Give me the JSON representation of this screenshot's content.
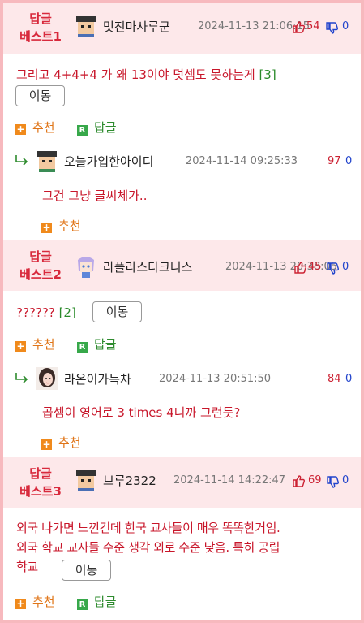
{
  "colors": {
    "border": "#f7b9be",
    "header_bg": "#fde8ea",
    "best_label": "#d8293c",
    "body_text": "#c8162a",
    "upvote": "#cc2233",
    "downvote": "#2244cc",
    "recommend": "#e0761a",
    "reply": "#2e8b2e"
  },
  "comments": [
    {
      "best_line1": "답글",
      "best_line2": "베스트1",
      "nickname": "멋진마사루군",
      "date": "2024-11-13 21:06:15",
      "upvotes": "54",
      "downvotes": "0",
      "text": "그리고 4+4+4 가 왜 13이야 덧셈도 못하는게",
      "reply_count": "[3]",
      "move_label": "이동",
      "recommend_label": "추천",
      "reply_label": "답글",
      "reply": {
        "nickname": "오늘가입한아이디",
        "date": "2024-11-14 09:25:33",
        "upvotes": "97",
        "downvotes": "0",
        "text": "그건 그냥 글씨체가..",
        "recommend_label": "추천"
      }
    },
    {
      "best_line1": "답글",
      "best_line2": "베스트2",
      "nickname": "라플라스다크니스",
      "date": "2024-11-13 20:38:05",
      "upvotes": "45",
      "downvotes": "0",
      "text": "??????",
      "reply_count": "[2]",
      "move_label": "이동",
      "recommend_label": "추천",
      "reply_label": "답글",
      "reply": {
        "nickname": "라온이가득차",
        "date": "2024-11-13 20:51:50",
        "upvotes": "84",
        "downvotes": "0",
        "text": "곱셈이 영어로 3 times 4니까 그런듯?",
        "recommend_label": "추천"
      }
    },
    {
      "best_line1": "답글",
      "best_line2": "베스트3",
      "nickname": "브루2322",
      "date": "2024-11-14 14:22:47",
      "upvotes": "69",
      "downvotes": "0",
      "text_line1": "외국 나가면 느낀건데 한국 교사들이 매우 똑똑한거임.",
      "text_line2": "외국 학교 교사들 수준 생각 외로 수준 낮음. 특히 공립",
      "text_line3": "학교",
      "move_label": "이동",
      "recommend_label": "추천",
      "reply_label": "답글"
    }
  ]
}
